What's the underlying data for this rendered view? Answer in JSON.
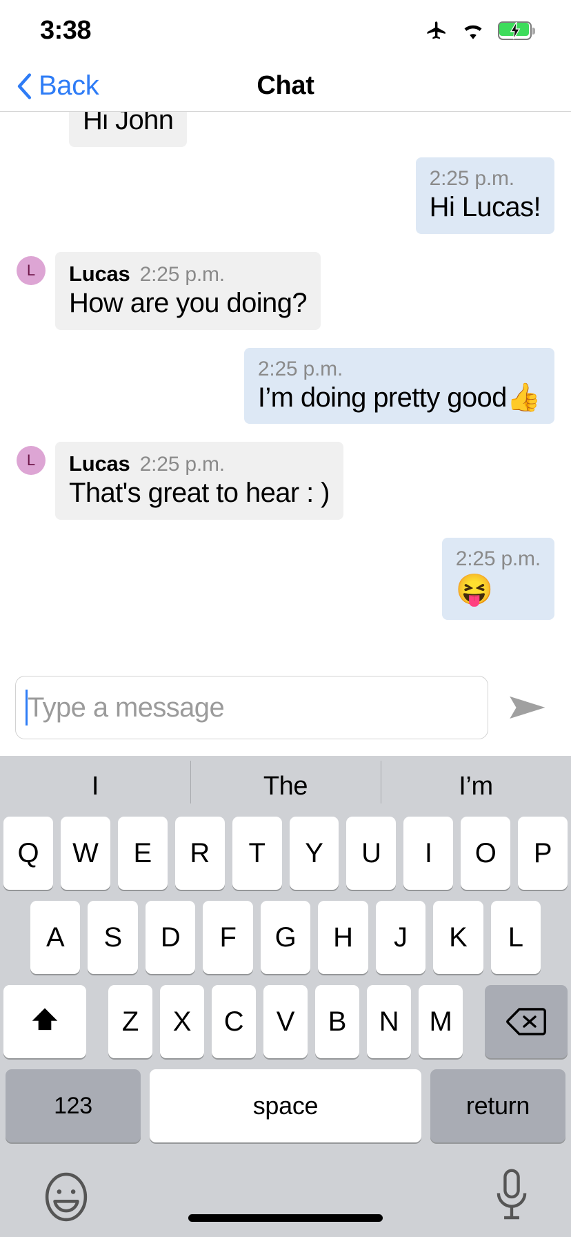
{
  "status_bar": {
    "time": "3:38",
    "icons": [
      "airplane-mode-icon",
      "wifi-icon",
      "battery-charging-icon"
    ]
  },
  "nav_bar": {
    "back_label": "Back",
    "title": "Chat"
  },
  "messages": [
    {
      "direction": "incoming",
      "sender": "",
      "time": "",
      "text": "Hi John",
      "clipped": true,
      "avatar_letter": ""
    },
    {
      "direction": "outgoing",
      "sender": "",
      "time": "2:25 p.m.",
      "text": "Hi Lucas!",
      "clipped": false,
      "avatar_letter": ""
    },
    {
      "direction": "incoming",
      "sender": "Lucas",
      "time": "2:25 p.m.",
      "text": "How are you doing?",
      "clipped": false,
      "avatar_letter": "L"
    },
    {
      "direction": "outgoing",
      "sender": "",
      "time": "2:25 p.m.",
      "text": "I’m doing pretty good👍",
      "clipped": false,
      "avatar_letter": ""
    },
    {
      "direction": "incoming",
      "sender": "Lucas",
      "time": "2:25 p.m.",
      "text": "That's great to hear : )",
      "clipped": false,
      "avatar_letter": "L"
    },
    {
      "direction": "outgoing",
      "sender": "",
      "time": "2:25 p.m.",
      "text": "😝",
      "clipped": false,
      "avatar_letter": ""
    }
  ],
  "input_bar": {
    "placeholder": "Type a message",
    "value": "",
    "send_icon": "send-arrow-icon"
  },
  "keyboard": {
    "predictions": [
      "I",
      "The",
      "I’m"
    ],
    "row1": [
      "Q",
      "W",
      "E",
      "R",
      "T",
      "Y",
      "U",
      "I",
      "O",
      "P"
    ],
    "row2": [
      "A",
      "S",
      "D",
      "F",
      "G",
      "H",
      "J",
      "K",
      "L"
    ],
    "row3": [
      "Z",
      "X",
      "C",
      "V",
      "B",
      "N",
      "M"
    ],
    "shift_label": "shift-icon",
    "delete_label": "delete-icon",
    "numbers_label": "123",
    "space_label": "space",
    "return_label": "return",
    "emoji_label": "emoji-icon",
    "mic_label": "microphone-icon"
  },
  "colors": {
    "accent_blue": "#2e7cf6",
    "incoming_bubble": "#f0f0f0",
    "outgoing_bubble": "#dde8f5",
    "avatar_bg": "#dda5d4",
    "avatar_fg": "#6d1548",
    "keyboard_bg": "#cfd1d5",
    "key_bg": "#ffffff",
    "mod_key_bg": "#a9acb4",
    "battery_green": "#3ddc5b"
  }
}
